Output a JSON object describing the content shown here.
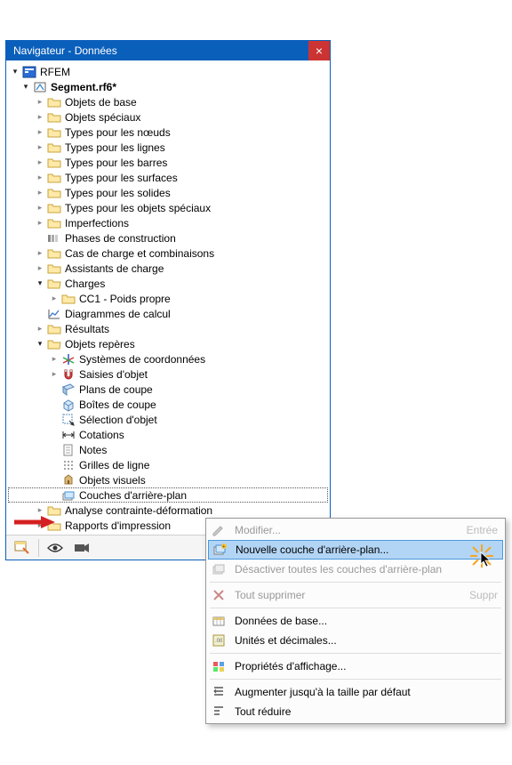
{
  "title": "Navigateur - Données",
  "root_app": "RFEM",
  "file_name": "Segment.rf6*",
  "tree2": [
    {
      "label": "Objets de base",
      "icon": "folder",
      "caret": "closed"
    },
    {
      "label": "Objets spéciaux",
      "icon": "folder",
      "caret": "closed"
    },
    {
      "label": "Types pour les nœuds",
      "icon": "folder",
      "caret": "closed"
    },
    {
      "label": "Types pour les lignes",
      "icon": "folder",
      "caret": "closed"
    },
    {
      "label": "Types pour les barres",
      "icon": "folder",
      "caret": "closed"
    },
    {
      "label": "Types pour les surfaces",
      "icon": "folder",
      "caret": "closed"
    },
    {
      "label": "Types pour les solides",
      "icon": "folder",
      "caret": "closed"
    },
    {
      "label": "Types pour les objets spéciaux",
      "icon": "folder",
      "caret": "closed"
    },
    {
      "label": "Imperfections",
      "icon": "folder",
      "caret": "closed"
    },
    {
      "label": "Phases de construction",
      "icon": "phases",
      "caret": "none"
    },
    {
      "label": "Cas de charge et combinaisons",
      "icon": "folder",
      "caret": "closed"
    },
    {
      "label": "Assistants de charge",
      "icon": "folder",
      "caret": "closed"
    }
  ],
  "charges_label": "Charges",
  "charges_child": "CC1 - Poids propre",
  "after_charges": [
    {
      "label": "Diagrammes de calcul",
      "icon": "diagram",
      "caret": "none"
    },
    {
      "label": "Résultats",
      "icon": "folder",
      "caret": "closed"
    }
  ],
  "objets_reperes_label": "Objets repères",
  "objets_reperes": [
    {
      "label": "Systèmes de coordonnées",
      "icon": "coords",
      "caret": "closed"
    },
    {
      "label": "Saisies d'objet",
      "icon": "magnet",
      "caret": "closed"
    },
    {
      "label": "Plans de coupe",
      "icon": "plans",
      "caret": "none"
    },
    {
      "label": "Boîtes de coupe",
      "icon": "boites",
      "caret": "none"
    },
    {
      "label": "Sélection d'objet",
      "icon": "selection",
      "caret": "none"
    },
    {
      "label": "Cotations",
      "icon": "cotation",
      "caret": "none"
    },
    {
      "label": "Notes",
      "icon": "notes",
      "caret": "none"
    },
    {
      "label": "Grilles de ligne",
      "icon": "grid",
      "caret": "none"
    },
    {
      "label": "Objets visuels",
      "icon": "visual",
      "caret": "none"
    },
    {
      "label": "Couches d'arrière-plan",
      "icon": "layers",
      "caret": "none",
      "selected": true
    }
  ],
  "after_reperes": [
    {
      "label": "Analyse contrainte-déformation",
      "icon": "folder",
      "caret": "closed"
    },
    {
      "label": "Rapports d'impression",
      "icon": "folder",
      "caret": "closed"
    }
  ],
  "menu": {
    "modify": "Modifier...",
    "modify_key": "Entrée",
    "new_layer": "Nouvelle couche d'arrière-plan...",
    "disable_all": "Désactiver toutes les couches d'arrière-plan",
    "delete_all": "Tout supprimer",
    "delete_all_key": "Suppr",
    "base_data": "Données de base...",
    "units": "Unités et décimales...",
    "display_props": "Propriétés d'affichage...",
    "expand": "Augmenter jusqu'à la taille par défaut",
    "collapse": "Tout réduire"
  }
}
